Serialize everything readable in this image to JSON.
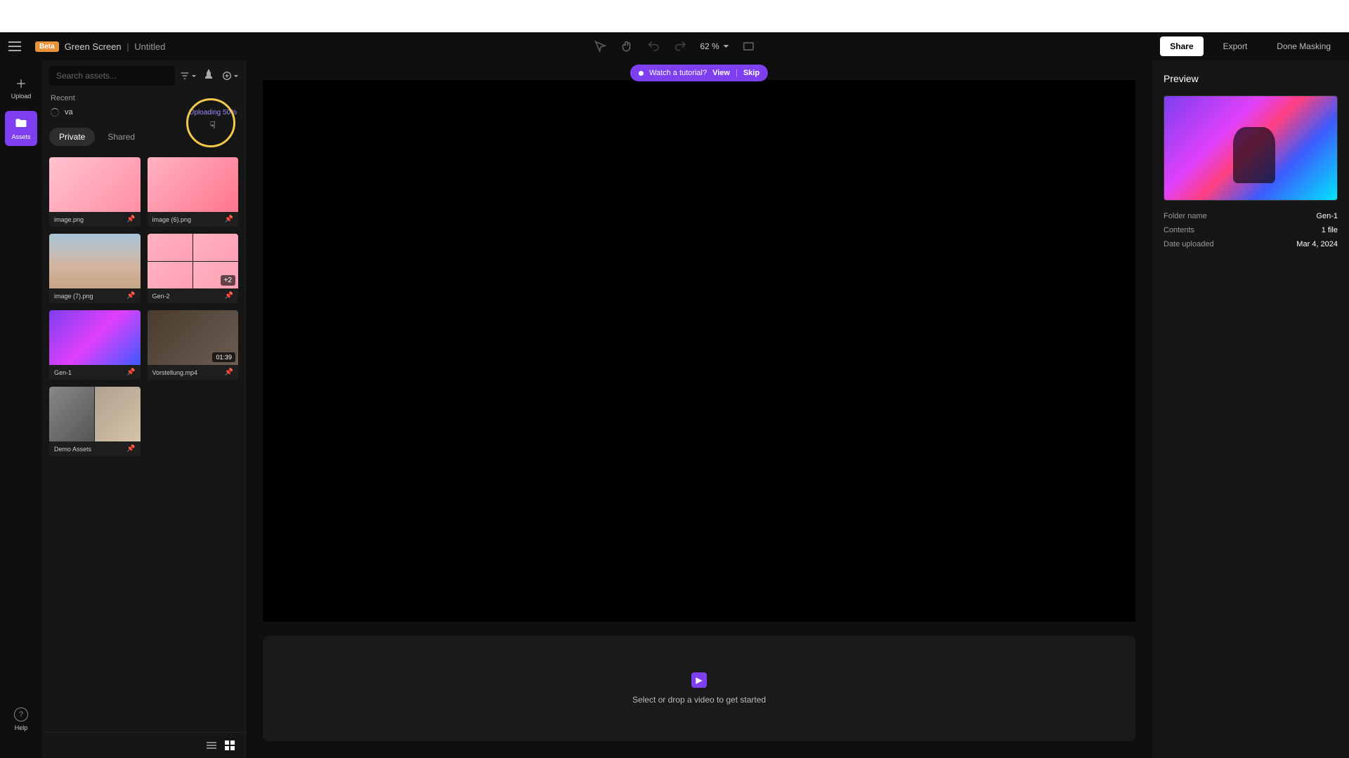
{
  "beta": "Beta",
  "breadcrumb": {
    "tool": "Green Screen",
    "project": "Untitled"
  },
  "zoom": "62 %",
  "buttons": {
    "share": "Share",
    "export": "Export",
    "done": "Done Masking"
  },
  "nav": {
    "upload": "Upload",
    "assets": "Assets",
    "help": "Help"
  },
  "search": {
    "placeholder": "Search assets..."
  },
  "recent": {
    "header": "Recent",
    "item_name": "va",
    "status": "Uploading 50%"
  },
  "tabs": {
    "private": "Private",
    "shared": "Shared"
  },
  "assets": [
    {
      "name": "image.png"
    },
    {
      "name": "image (6).png"
    },
    {
      "name": "image (7).png"
    },
    {
      "name": "Gen-2",
      "more": "+2"
    },
    {
      "name": "Gen-1"
    },
    {
      "name": "Vorstellung.mp4",
      "duration": "01:39"
    },
    {
      "name": "Demo Assets"
    }
  ],
  "tutorial": {
    "text": "Watch a tutorial?",
    "view": "View",
    "skip": "Skip"
  },
  "preview": {
    "title": "Preview",
    "folder_label": "Folder name",
    "folder_val": "Gen-1",
    "contents_label": "Contents",
    "contents_val": "1 file",
    "date_label": "Date uploaded",
    "date_val": "Mar 4, 2024"
  },
  "timeline": {
    "hint": "Select or drop a video to get started"
  }
}
